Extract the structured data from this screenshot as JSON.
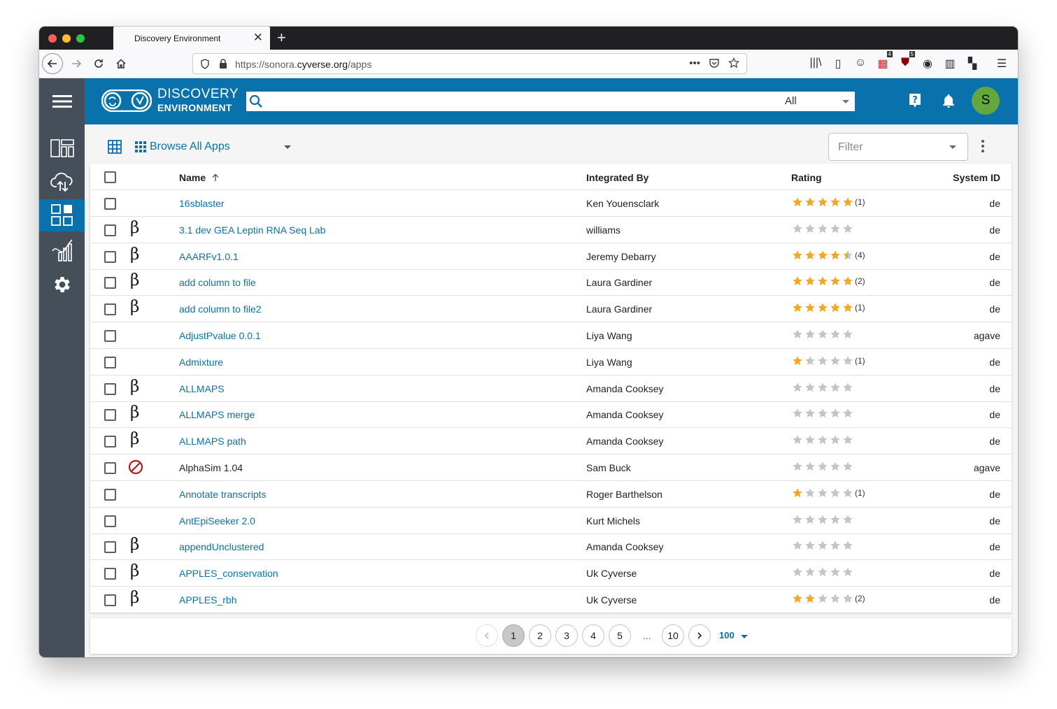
{
  "browser": {
    "tab_title": "Discovery Environment",
    "url_prefix": "https://sonora.",
    "url_domain": "cyverse.org",
    "url_path": "/apps",
    "badge_counts": [
      "4",
      "5"
    ]
  },
  "appbar": {
    "logo_title": "DISCOVERY",
    "logo_subtitle": "ENVIRONMENT",
    "search_placeholder": "",
    "search_scope": "All",
    "avatar_initial": "S"
  },
  "toolbar": {
    "browse_label": "Browse All Apps",
    "filter_label": "Filter"
  },
  "table": {
    "headers": {
      "name": "Name",
      "name_sort_icon": "arrow-up-icon",
      "integrated_by": "Integrated By",
      "rating": "Rating",
      "system_id": "System ID"
    },
    "rows": [
      {
        "name": "16sblaster",
        "beta": false,
        "disabled": false,
        "integrator": "Ken Youensclark",
        "rating": 5,
        "count": "(1)",
        "system": "de"
      },
      {
        "name": "3.1 dev GEA Leptin RNA Seq Lab",
        "beta": true,
        "disabled": false,
        "integrator": "williams",
        "rating": 0,
        "count": "",
        "system": "de"
      },
      {
        "name": "AAARFv1.0.1",
        "beta": true,
        "disabled": false,
        "integrator": "Jeremy Debarry",
        "rating": 4.5,
        "count": "(4)",
        "system": "de"
      },
      {
        "name": "add column to file",
        "beta": true,
        "disabled": false,
        "integrator": "Laura Gardiner",
        "rating": 5,
        "count": "(2)",
        "system": "de"
      },
      {
        "name": "add column to file2",
        "beta": true,
        "disabled": false,
        "integrator": "Laura Gardiner",
        "rating": 5,
        "count": "(1)",
        "system": "de"
      },
      {
        "name": "AdjustPvalue 0.0.1",
        "beta": false,
        "disabled": false,
        "integrator": "Liya Wang",
        "rating": 0,
        "count": "",
        "system": "agave"
      },
      {
        "name": "Admixture",
        "beta": false,
        "disabled": false,
        "integrator": "Liya Wang",
        "rating": 1,
        "count": "(1)",
        "system": "de"
      },
      {
        "name": "ALLMAPS",
        "beta": true,
        "disabled": false,
        "integrator": "Amanda Cooksey",
        "rating": 0,
        "count": "",
        "system": "de"
      },
      {
        "name": "ALLMAPS merge",
        "beta": true,
        "disabled": false,
        "integrator": "Amanda Cooksey",
        "rating": 0,
        "count": "",
        "system": "de"
      },
      {
        "name": "ALLMAPS path",
        "beta": true,
        "disabled": false,
        "integrator": "Amanda Cooksey",
        "rating": 0,
        "count": "",
        "system": "de"
      },
      {
        "name": "AlphaSim 1.04",
        "beta": false,
        "disabled": true,
        "integrator": "Sam Buck",
        "rating": 0,
        "count": "",
        "system": "agave"
      },
      {
        "name": "Annotate transcripts",
        "beta": false,
        "disabled": false,
        "integrator": "Roger Barthelson",
        "rating": 1,
        "count": "(1)",
        "system": "de"
      },
      {
        "name": "AntEpiSeeker 2.0",
        "beta": false,
        "disabled": false,
        "integrator": "Kurt Michels",
        "rating": 0,
        "count": "",
        "system": "de"
      },
      {
        "name": "appendUnclustered",
        "beta": true,
        "disabled": false,
        "integrator": "Amanda Cooksey",
        "rating": 0,
        "count": "",
        "system": "de"
      },
      {
        "name": "APPLES_conservation",
        "beta": true,
        "disabled": false,
        "integrator": "Uk Cyverse",
        "rating": 0,
        "count": "",
        "system": "de"
      },
      {
        "name": "APPLES_rbh",
        "beta": true,
        "disabled": false,
        "integrator": "Uk Cyverse",
        "rating": 2,
        "count": "(2)",
        "system": "de"
      }
    ],
    "beta_symbol": "β"
  },
  "pagination": {
    "pages": [
      "1",
      "2",
      "3",
      "4",
      "5"
    ],
    "ellipsis": "...",
    "last_page": "10",
    "current_page": "1",
    "page_size": "100"
  },
  "colors": {
    "accent": "#0971ab",
    "sidebar": "#444f5a",
    "star_filled": "#f5a623",
    "star_empty": "#c4c4c4",
    "disabled_icon": "#b71c1c",
    "avatar": "#62a83d"
  }
}
